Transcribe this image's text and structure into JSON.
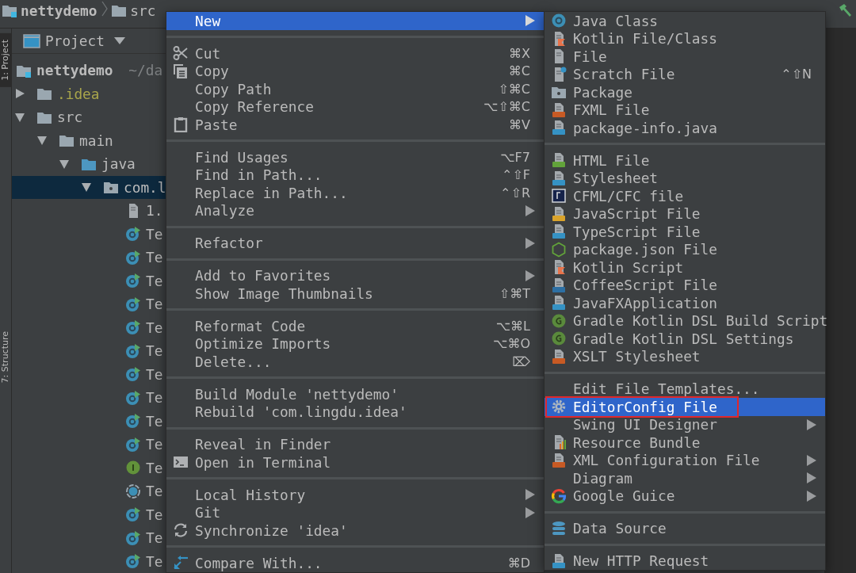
{
  "tool_strip": {
    "tabs": [
      {
        "label": "1: Project",
        "selected": true
      },
      {
        "label": "7: Structure",
        "selected": false
      }
    ]
  },
  "breadcrumb": [
    {
      "label": "nettydemo",
      "kind": "module"
    },
    {
      "label": "src",
      "kind": "folder"
    }
  ],
  "project_panel": {
    "title": "Project",
    "tree": [
      {
        "label": "nettydemo",
        "path": "~/da",
        "kind": "module",
        "selected": false,
        "children": [
          {
            "label": ".idea",
            "kind": "folder",
            "color": "#a9a54b",
            "expanded": false,
            "selected": false
          },
          {
            "label": "src",
            "kind": "folder",
            "expanded": true,
            "selected": false,
            "children": [
              {
                "label": "main",
                "kind": "folder",
                "expanded": true,
                "selected": false,
                "children": [
                  {
                    "label": "java",
                    "kind": "source-folder",
                    "expanded": true,
                    "selected": false,
                    "children": [
                      {
                        "label": "com.l",
                        "kind": "package-folder",
                        "expanded": true,
                        "selected": true,
                        "children": [
                          {
                            "label": "1.",
                            "kind": "text-file",
                            "selected": false
                          },
                          {
                            "label": "Te",
                            "kind": "runnable-class",
                            "selected": false
                          },
                          {
                            "label": "Te",
                            "kind": "runnable-class",
                            "selected": false
                          },
                          {
                            "label": "Te",
                            "kind": "runnable-class",
                            "selected": false
                          },
                          {
                            "label": "Te",
                            "kind": "runnable-class",
                            "selected": false
                          },
                          {
                            "label": "Te",
                            "kind": "runnable-class",
                            "selected": false
                          },
                          {
                            "label": "Te",
                            "kind": "runnable-class",
                            "selected": false
                          },
                          {
                            "label": "Te",
                            "kind": "runnable-class",
                            "selected": false
                          },
                          {
                            "label": "Te",
                            "kind": "runnable-class",
                            "selected": false
                          },
                          {
                            "label": "Te",
                            "kind": "runnable-class",
                            "selected": false
                          },
                          {
                            "label": "Te",
                            "kind": "runnable-class",
                            "selected": false
                          },
                          {
                            "label": "Te",
                            "kind": "interface",
                            "selected": false
                          },
                          {
                            "label": "Te",
                            "kind": "abstract-class",
                            "selected": false
                          },
                          {
                            "label": "Te",
                            "kind": "runnable-class",
                            "selected": false
                          },
                          {
                            "label": "Te",
                            "kind": "runnable-class",
                            "selected": false
                          },
                          {
                            "label": "Te",
                            "kind": "runnable-class",
                            "selected": false
                          }
                        ]
                      }
                    ]
                  }
                ]
              }
            ]
          }
        ]
      }
    ]
  },
  "context_menu": {
    "groups": [
      {
        "items": [
          {
            "label": "New",
            "kind": "none",
            "selected": true,
            "submenu": true
          }
        ]
      },
      {
        "items": [
          {
            "label": "Cut",
            "kind": "cut",
            "shortcut": "⌘X",
            "selected": false,
            "submenu": false
          },
          {
            "label": "Copy",
            "kind": "copy",
            "shortcut": "⌘C",
            "selected": false,
            "submenu": false
          },
          {
            "label": "Copy Path",
            "kind": "none",
            "shortcut": "⇧⌘C",
            "selected": false,
            "submenu": false
          },
          {
            "label": "Copy Reference",
            "kind": "none",
            "shortcut": "⌥⇧⌘C",
            "selected": false,
            "submenu": false
          },
          {
            "label": "Paste",
            "kind": "paste",
            "shortcut": "⌘V",
            "selected": false,
            "submenu": false
          }
        ]
      },
      {
        "items": [
          {
            "label": "Find Usages",
            "kind": "none",
            "shortcut": "⌥F7",
            "selected": false,
            "submenu": false
          },
          {
            "label": "Find in Path...",
            "kind": "none",
            "shortcut": "⌃⇧F",
            "selected": false,
            "submenu": false
          },
          {
            "label": "Replace in Path...",
            "kind": "none",
            "shortcut": "⌃⇧R",
            "selected": false,
            "submenu": false
          },
          {
            "label": "Analyze",
            "kind": "none",
            "selected": false,
            "submenu": true
          }
        ]
      },
      {
        "items": [
          {
            "label": "Refactor",
            "kind": "none",
            "selected": false,
            "submenu": true
          }
        ]
      },
      {
        "items": [
          {
            "label": "Add to Favorites",
            "kind": "none",
            "selected": false,
            "submenu": true
          },
          {
            "label": "Show Image Thumbnails",
            "kind": "none",
            "shortcut": "⇧⌘T",
            "selected": false,
            "submenu": false
          }
        ]
      },
      {
        "items": [
          {
            "label": "Reformat Code",
            "kind": "none",
            "shortcut": "⌥⌘L",
            "selected": false,
            "submenu": false
          },
          {
            "label": "Optimize Imports",
            "kind": "none",
            "shortcut": "⌥⌘O",
            "selected": false,
            "submenu": false
          },
          {
            "label": "Delete...",
            "kind": "none",
            "shortcut": "⌦",
            "selected": false,
            "submenu": false
          }
        ]
      },
      {
        "items": [
          {
            "label": "Build Module 'nettydemo'",
            "kind": "none",
            "selected": false,
            "submenu": false
          },
          {
            "label": "Rebuild 'com.lingdu.idea'",
            "kind": "none",
            "selected": false,
            "submenu": false
          }
        ]
      },
      {
        "items": [
          {
            "label": "Reveal in Finder",
            "kind": "none",
            "selected": false,
            "submenu": false
          },
          {
            "label": "Open in Terminal",
            "kind": "terminal",
            "selected": false,
            "submenu": false
          }
        ]
      },
      {
        "items": [
          {
            "label": "Local History",
            "kind": "none",
            "selected": false,
            "submenu": true
          },
          {
            "label": "Git",
            "kind": "none",
            "selected": false,
            "submenu": true
          },
          {
            "label": "Synchronize 'idea'",
            "kind": "sync",
            "selected": false,
            "submenu": false
          }
        ]
      },
      {
        "items": [
          {
            "label": "Compare With...",
            "kind": "compare",
            "shortcut": "⌘D",
            "selected": false,
            "submenu": false
          }
        ]
      }
    ]
  },
  "new_submenu": {
    "groups": [
      {
        "items": [
          {
            "label": "Java Class",
            "kind": "class",
            "selected": false,
            "submenu": false,
            "outlined": false
          },
          {
            "label": "Kotlin File/Class",
            "kind": "kotlin-file",
            "selected": false,
            "submenu": false,
            "outlined": false
          },
          {
            "label": "File",
            "kind": "file",
            "selected": false,
            "submenu": false,
            "outlined": false
          },
          {
            "label": "Scratch File",
            "kind": "scratch-file",
            "shortcut": "⌃⇧N",
            "selected": false,
            "submenu": false,
            "outlined": false
          },
          {
            "label": "Package",
            "kind": "package",
            "selected": false,
            "submenu": false,
            "outlined": false
          },
          {
            "label": "FXML File",
            "kind": "xml-file",
            "selected": false,
            "submenu": false,
            "outlined": false
          },
          {
            "label": "package-info.java",
            "kind": "java-file",
            "selected": false,
            "submenu": false,
            "outlined": false
          }
        ]
      },
      {
        "items": [
          {
            "label": "HTML File",
            "kind": "html-file",
            "selected": false,
            "submenu": false,
            "outlined": false
          },
          {
            "label": "Stylesheet",
            "kind": "css-file",
            "selected": false,
            "submenu": false,
            "outlined": false
          },
          {
            "label": "CFML/CFC file",
            "kind": "cfml",
            "selected": false,
            "submenu": false,
            "outlined": false
          },
          {
            "label": "JavaScript File",
            "kind": "js-file",
            "selected": false,
            "submenu": false,
            "outlined": false
          },
          {
            "label": "TypeScript File",
            "kind": "ts-file",
            "selected": false,
            "submenu": false,
            "outlined": false
          },
          {
            "label": "package.json File",
            "kind": "node",
            "selected": false,
            "submenu": false,
            "outlined": false
          },
          {
            "label": "Kotlin Script",
            "kind": "kotlin-file",
            "selected": false,
            "submenu": false,
            "outlined": false
          },
          {
            "label": "CoffeeScript File",
            "kind": "coffee-file",
            "selected": false,
            "submenu": false,
            "outlined": false
          },
          {
            "label": "JavaFXApplication",
            "kind": "java-file",
            "selected": false,
            "submenu": false,
            "outlined": false
          },
          {
            "label": "Gradle Kotlin DSL Build Script",
            "kind": "gradle",
            "selected": false,
            "submenu": false,
            "outlined": false
          },
          {
            "label": "Gradle Kotlin DSL Settings",
            "kind": "gradle",
            "selected": false,
            "submenu": false,
            "outlined": false
          },
          {
            "label": "XSLT Stylesheet",
            "kind": "xml-file",
            "selected": false,
            "submenu": false,
            "outlined": false
          }
        ]
      },
      {
        "items": [
          {
            "label": "Edit File Templates...",
            "kind": "none",
            "selected": false,
            "submenu": false,
            "outlined": false
          },
          {
            "label": "EditorConfig File",
            "kind": "gear",
            "selected": true,
            "submenu": false,
            "outlined": true
          },
          {
            "label": "Swing UI Designer",
            "kind": "none",
            "selected": false,
            "submenu": true,
            "outlined": false
          },
          {
            "label": "Resource Bundle",
            "kind": "bundle",
            "selected": false,
            "submenu": false,
            "outlined": false
          },
          {
            "label": "XML Configuration File",
            "kind": "xml-file",
            "selected": false,
            "submenu": true,
            "outlined": false
          },
          {
            "label": "Diagram",
            "kind": "none",
            "selected": false,
            "submenu": true,
            "outlined": false
          },
          {
            "label": "Google Guice",
            "kind": "google",
            "selected": false,
            "submenu": true,
            "outlined": false
          }
        ]
      },
      {
        "items": [
          {
            "label": "Data Source",
            "kind": "database",
            "selected": false,
            "submenu": false,
            "outlined": false
          }
        ]
      },
      {
        "items": [
          {
            "label": "New HTTP Request",
            "kind": "http-file",
            "selected": false,
            "submenu": false,
            "outlined": false
          }
        ]
      }
    ]
  }
}
